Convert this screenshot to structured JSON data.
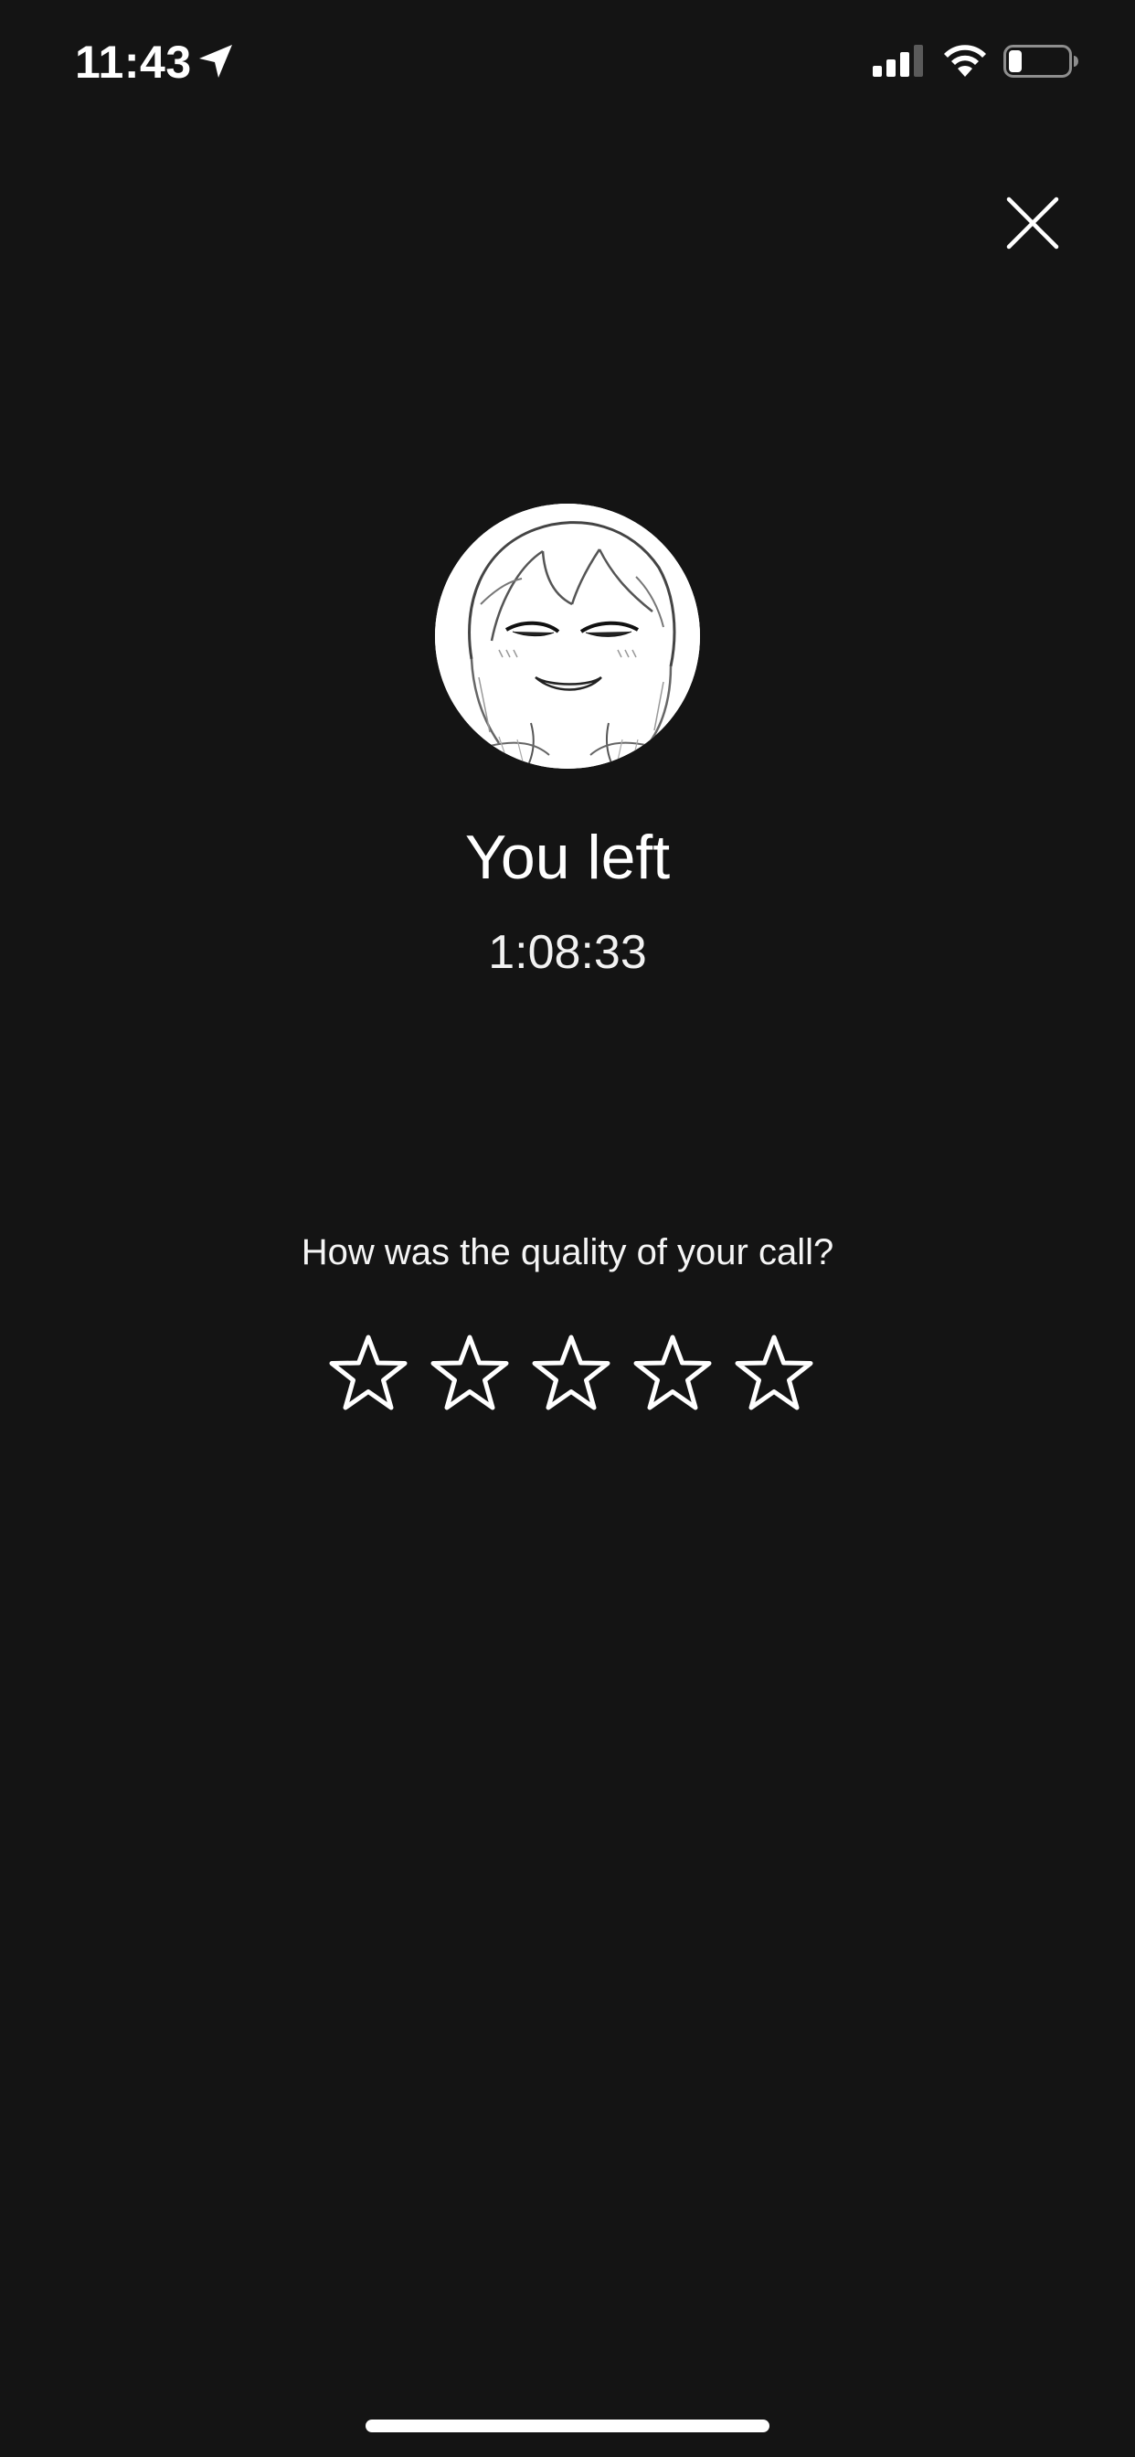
{
  "status_bar": {
    "time": "11:43",
    "location_icon": "location-arrow-icon",
    "signal_icon": "cellular-signal-icon",
    "wifi_icon": "wifi-icon",
    "battery_icon": "battery-icon"
  },
  "close_icon": "close-icon",
  "avatar_icon": "avatar",
  "call": {
    "status": "You left",
    "duration": "1:08:33"
  },
  "rating": {
    "question": "How was the quality of your call?",
    "max_stars": 5,
    "selected": 0
  },
  "colors": {
    "background": "#141414",
    "foreground": "#ffffff"
  }
}
